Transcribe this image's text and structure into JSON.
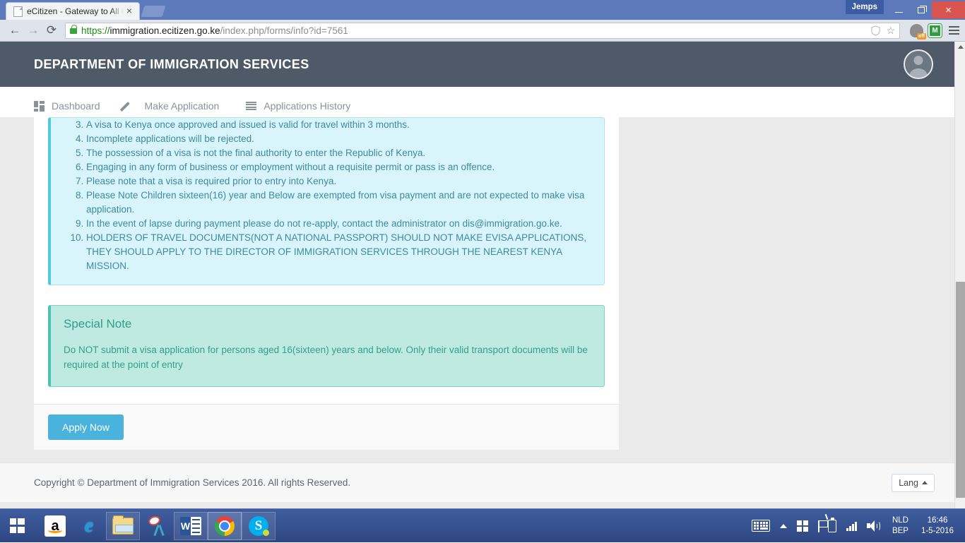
{
  "browser": {
    "tab": {
      "title": "eCitizen - Gateway to All G",
      "favicon_name": "page-icon",
      "close_label": "×",
      "new_tab_label": ""
    },
    "window": {
      "user_label": "Jemps",
      "minimize_label": "",
      "maximize_label": "",
      "close_label": "×"
    },
    "toolbar": {
      "back_label": "←",
      "forward_label": "→",
      "reload_label": "⟳",
      "url_scheme": "https://",
      "url_host": "immigration.ecitizen.go.ke",
      "url_path": "/index.php/forms/info?id=7561",
      "url_full": "https://immigration.ecitizen.go.ke/index.php/forms/info?id=7561",
      "shield_icon": "shield-icon",
      "star_label": "☆",
      "ext_ghostery": "off",
      "ext_mcafee": "M",
      "menu_icon": "hamburger-menu-icon"
    }
  },
  "site": {
    "header_title": "DEPARTMENT OF IMMIGRATION SERVICES",
    "avatar_name": "user-avatar"
  },
  "nav": {
    "items": [
      {
        "label": "Dashboard",
        "icon": "grid-icon"
      },
      {
        "label": "Make Application",
        "icon": "pencil-icon"
      },
      {
        "label": "Applications History",
        "icon": "list-icon"
      }
    ]
  },
  "notes": {
    "items": [
      "A visa to Kenya once approved and issued is valid for travel within 3 months.",
      "Incomplete applications will be rejected.",
      "The possession of a visa is not the final authority to enter the Republic of Kenya.",
      "Engaging in any form of business or employment without a requisite permit or pass is an offence.",
      "Please note that a visa is required prior to entry into Kenya.",
      "Please Note Children sixteen(16) year and Below are exempted from visa payment and are not expected to make visa application.",
      "In the event of lapse during payment please do not re-apply, contact the administrator on dis@immigration.go.ke.",
      "HOLDERS OF TRAVEL DOCUMENTS(NOT A NATIONAL PASSPORT) SHOULD NOT MAKE EVISA APPLICATIONS, THEY SHOULD APPLY TO THE DIRECTOR OF IMMIGRATION SERVICES THROUGH THE NEAREST KENYA MISSION."
    ],
    "start_number": 3
  },
  "special_note": {
    "heading": "Special Note",
    "body": "Do NOT submit a visa application for persons aged 16(sixteen) years and below. Only their valid transport documents will be required at the point of entry"
  },
  "actions": {
    "apply_label": "Apply Now"
  },
  "footer": {
    "copyright": "Copyright © Department of Immigration Services 2016. All rights Reserved.",
    "lang_label": "Lang"
  },
  "taskbar": {
    "start_name": "windows-start-button",
    "apps": [
      {
        "name": "amazon-icon",
        "label": "a"
      },
      {
        "name": "internet-explorer-icon",
        "label": "e"
      },
      {
        "name": "file-explorer-icon",
        "label": ""
      },
      {
        "name": "snipping-tool-icon",
        "label": ""
      },
      {
        "name": "microsoft-word-icon",
        "label": "W"
      },
      {
        "name": "google-chrome-icon",
        "label": ""
      },
      {
        "name": "skype-icon",
        "label": "S"
      }
    ],
    "tray": {
      "keyboard_icon": "keyboard-icon",
      "show_hidden_icon": "show-hidden-icons-caret",
      "windows_icon": "windows-icon",
      "flag_icon": "action-center-flag-icon",
      "battery_icon": "battery-icon",
      "signal_icon": "network-signal-icon",
      "volume_icon": "volume-icon",
      "lang_line1": "NLD",
      "lang_line2": "BEP",
      "time": "16:46",
      "date": "1-5-2016"
    }
  },
  "colors": {
    "header_bg": "#4f5a68",
    "info_bg": "#d9f5fb",
    "info_text": "#3a8ba1",
    "success_bg": "#bfeae2",
    "success_text": "#33a089",
    "button_primary": "#4ab3dd",
    "taskbar": "#2e4783"
  }
}
